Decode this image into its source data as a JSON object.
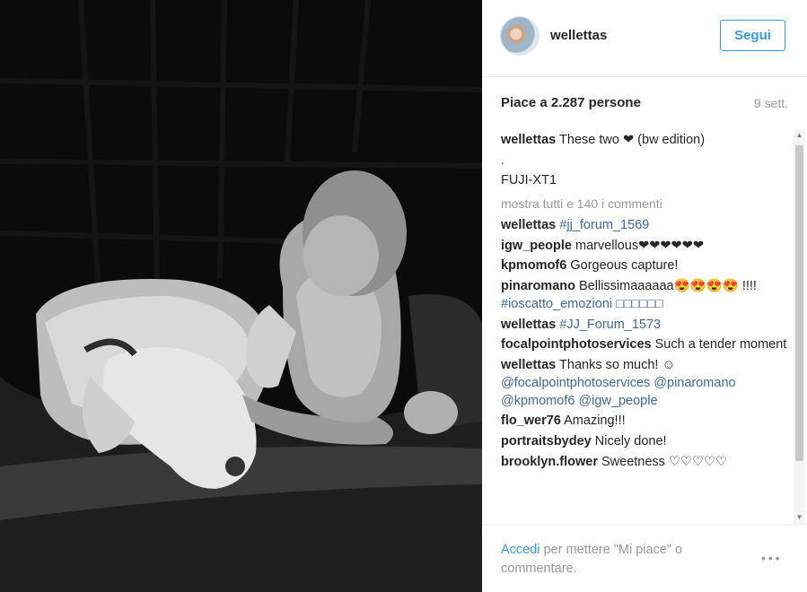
{
  "post": {
    "photo_alt": "Black and white photo of a baby sitting next to a sleeping dog on an armchair"
  },
  "header": {
    "username": "wellettas",
    "follow_label": "Segui"
  },
  "meta": {
    "likes": "Piace a 2.287 persone",
    "time": "9 sett."
  },
  "comments": {
    "caption_user": "wellettas",
    "caption_text": "These two ❤ (bw edition)",
    "caption_dot": ".",
    "caption_camera": "FUJI-XT1",
    "show_all": "mostra tutti e 140 i commenti",
    "items": [
      {
        "user": "wellettas",
        "text": "",
        "tag": "#jj_forum_1569"
      },
      {
        "user": "igw_people",
        "text": "marvellous❤❤❤❤❤❤",
        "tag": ""
      },
      {
        "user": "kpmomof6",
        "text": "Gorgeous capture!",
        "tag": ""
      },
      {
        "user": "pinaromano",
        "text": "Bellissimaaaaaa😍😍😍😍 !!!!",
        "tag": "#ioscatto_emozioni □□□□□□"
      },
      {
        "user": "wellettas",
        "text": "",
        "tag": "#JJ_Forum_1573"
      },
      {
        "user": "focalpointphotoservices",
        "text": "Such a tender moment",
        "tag": ""
      },
      {
        "user": "wellettas",
        "text": "Thanks so much! ☺",
        "tag": "@focalpointphotoservices @pinaromano @kpmomof6 @igw_people"
      },
      {
        "user": "flo_wer76",
        "text": "Amazing!!!",
        "tag": ""
      },
      {
        "user": "portraitsbydey",
        "text": "Nicely done!",
        "tag": ""
      },
      {
        "user": "brooklyn.flower",
        "text": "Sweetness ♡♡♡♡♡",
        "tag": ""
      }
    ]
  },
  "footer": {
    "login_link": "Accedi",
    "login_rest": " per mettere \"Mi piace\" o commentare.",
    "more_dots": "•••"
  },
  "icons": {
    "scroll_up": "scroll-up-arrow",
    "scroll_down": "scroll-down-arrow"
  }
}
